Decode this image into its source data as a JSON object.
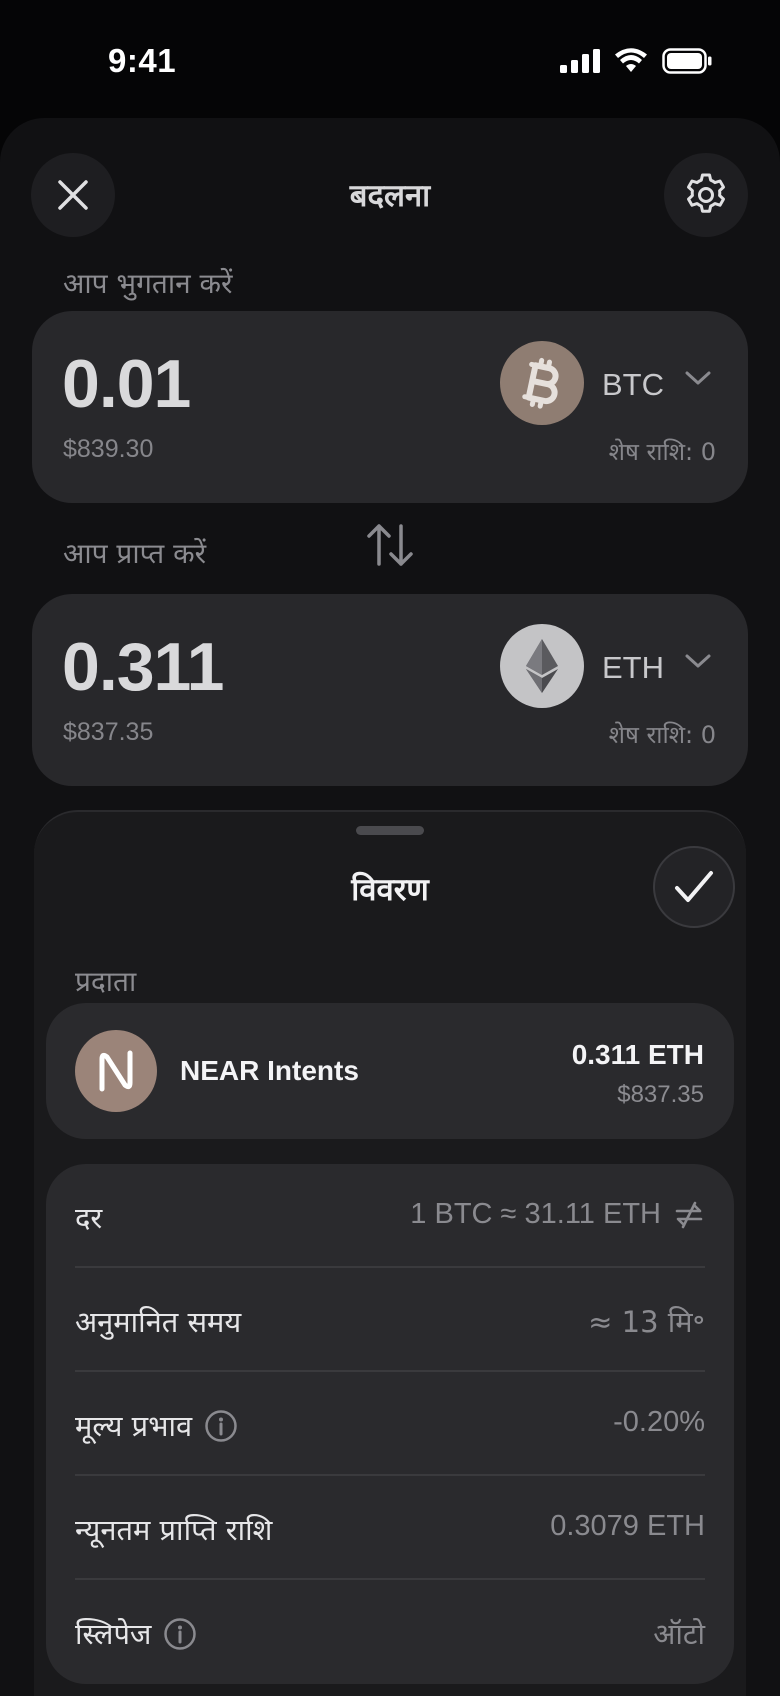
{
  "status_bar": {
    "time": "9:41"
  },
  "header": {
    "title": "बदलना"
  },
  "pay": {
    "label": "आप भुगतान करें",
    "amount": "0.01",
    "fiat": "$839.30",
    "token": "BTC",
    "balance": "शेष राशि: 0"
  },
  "receive": {
    "label": "आप प्राप्त करें",
    "amount": "0.311",
    "fiat": "$837.35",
    "token": "ETH",
    "balance": "शेष राशि: 0"
  },
  "details": {
    "title": "विवरण",
    "provider_label": "प्रदाता",
    "provider": {
      "name": "NEAR Intents",
      "amount": "0.311 ETH",
      "fiat": "$837.35"
    },
    "rows": [
      {
        "label": "दर",
        "value": "1 BTC ≈ 31.11 ETH"
      },
      {
        "label": "अनुमानित समय",
        "value": "≈ 13 मि॰"
      },
      {
        "label": "मूल्य प्रभाव",
        "value": "-0.20%"
      },
      {
        "label": "न्यूनतम प्राप्ति राशि",
        "value": "0.3079 ETH"
      },
      {
        "label": "स्लिपेज",
        "value": "ऑटो"
      }
    ]
  },
  "colors": {
    "background": "#050506",
    "card": "#28282b",
    "btc_icon": "#8f7d72",
    "eth_icon": "#c4c4c6",
    "near_logo": "#9b8479"
  },
  "icons": [
    "close-icon",
    "gear-icon",
    "bitcoin-icon",
    "ethereum-icon",
    "chevron-down-icon",
    "swap-arrows-icon",
    "checkmark-icon",
    "near-logo-icon",
    "info-icon",
    "invert-rate-icon"
  ]
}
